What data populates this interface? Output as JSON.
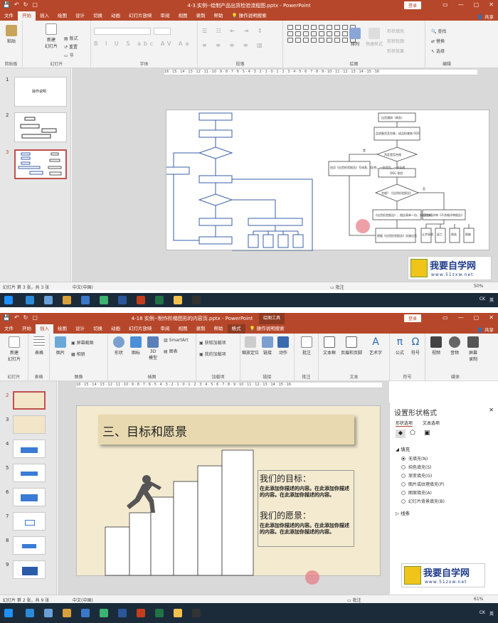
{
  "top": {
    "title": "4-3.实例--绘制产品出货检验流程图.pptx  -  PowerPoint",
    "login_label": "登录",
    "share_label": "共享",
    "tabs": [
      "文件",
      "开始",
      "插入",
      "绘图",
      "设计",
      "切换",
      "动画",
      "幻灯片放映",
      "审阅",
      "视图",
      "录制",
      "帮助",
      "操作说明搜索"
    ],
    "active_tab": "开始",
    "groups": {
      "clipboard": {
        "label": "剪贴板",
        "paste": "粘贴"
      },
      "slides": {
        "label": "幻灯片",
        "new_slide": "新建\n幻灯片",
        "layout": "版式",
        "reset": "重置",
        "section": "节"
      },
      "font": {
        "label": "字体"
      },
      "paragraph": {
        "label": "段落"
      },
      "drawing": {
        "label": "绘图",
        "arrange": "排列",
        "quick_styles": "快速样式",
        "fill": "形状填充",
        "outline": "形状轮廓",
        "effects": "形状效果"
      },
      "editing": {
        "label": "编辑",
        "find": "查找",
        "replace": "替换",
        "select": "选择"
      }
    },
    "slide_numbers": [
      "1",
      "2",
      "3"
    ],
    "thumb1_text": "操作说明",
    "ruler": "16 · 15 · 14 · 13 · 12 · 11 · 10 · 9 · 8 · 7 · 6 · 5 · 4 · 3 · 2 · 1 · 0 · 1 · 2 · 3 · 4 · 5 · 6 · 7 · 8 · 9 · 10 · 11 · 12 · 13 · 14 · 15 · 16",
    "flow_right": {
      "n1": "出货通知（商务）",
      "n2": "品质备货及包装，成品检查抽 OQC",
      "n3": "判定是否合格",
      "n4": "OQC 检验",
      "n5": "合格？《出货检验报告》",
      "n6": "《出货检验报告》、相应表单一份、依据相关",
      "n7": "不合格评审《不合格评审报告》",
      "n8": "根据《出货检验报告》实施出货",
      "left_note": "由员《出货检验报告》写成表，组/线，一份会同，一份存档",
      "yes": "是",
      "no": "否",
      "boxes": [
        "让步接收",
        "返工",
        "挑选",
        "报废"
      ]
    },
    "status": {
      "slide_info": "幻灯片 第 3 张，共 3 张",
      "lang": "中文(中国)",
      "comments": "批注",
      "zoom": "50%"
    },
    "tray": {
      "ime": "CK",
      "lang": "英"
    }
  },
  "bottom": {
    "title": "4-18 实例--制作阶梯图形的内容页.pptx  -  PowerPoint",
    "context_tab": "绘图工具",
    "login_label": "登录",
    "share_label": "共享",
    "tabs": [
      "文件",
      "开始",
      "插入",
      "绘图",
      "设计",
      "切换",
      "动画",
      "幻灯片放映",
      "审阅",
      "视图",
      "录制",
      "帮助",
      "格式",
      "操作说明搜索"
    ],
    "active_tab": "插入",
    "groups": {
      "slides": {
        "label": "幻灯片",
        "new": "新建\n幻灯片"
      },
      "tables": {
        "label": "表格",
        "table": "表格"
      },
      "images": {
        "label": "图像",
        "pictures": "图片",
        "screenshot": "屏幕截图",
        "album": "相册"
      },
      "illustrations": {
        "label": "插图",
        "shapes": "形状",
        "icons": "图标",
        "model3d": "3D\n模型",
        "smartart": "SmartArt",
        "chart": "图表"
      },
      "addins": {
        "label": "加载项",
        "get": "获取加载项",
        "mine": "我的加载项"
      },
      "links": {
        "label": "链接",
        "zoom": "缩放定位",
        "link": "链接",
        "action": "动作"
      },
      "comments": {
        "label": "批注",
        "comment": "批注"
      },
      "text": {
        "label": "文本",
        "textbox": "文本框",
        "header": "页眉和页脚",
        "wordart": "艺术字"
      },
      "symbols": {
        "label": "符号",
        "equation": "公式",
        "symbol": "符号"
      },
      "media": {
        "label": "媒体",
        "video": "视频",
        "audio": "音频",
        "record": "屏幕\n录制"
      }
    },
    "slide_numbers": [
      "2",
      "3",
      "4",
      "5",
      "6",
      "7",
      "8",
      "9"
    ],
    "slide": {
      "heading": "三、目标和愿景",
      "goal_title": "我们的目标：",
      "goal_body": "在此添加你描述的内容。在此添加你描述的内容。在此添加你描述的内容。",
      "vision_title": "我们的愿景：",
      "vision_body": "在此添加你描述的内容。在此添加你描述的内容。在此添加你描述的内容。"
    },
    "format_pane": {
      "title": "设置形状格式",
      "tabs": [
        "形状选项",
        "文本选项"
      ],
      "fill_section": "填充",
      "options": [
        "无填充(N)",
        "纯色填充(S)",
        "渐变填充(G)",
        "图片或纹理填充(P)",
        "图案填充(A)",
        "幻灯片背景填充(B)"
      ],
      "selected": 0,
      "line_section": "线条"
    },
    "logo": {
      "main": "我要自学网",
      "url": "www.51zxw.net"
    },
    "status": {
      "slide_info": "幻灯片 第 2 张，共 9 张",
      "lang": "中文(中国)",
      "comments": "批注",
      "zoom": "61%"
    },
    "tray": {
      "ime": "CK",
      "lang": "英"
    }
  },
  "colors": {
    "accent": "#b7472a",
    "taskbar": "#1b2b3a",
    "flow_line": "#3a5fa8"
  }
}
